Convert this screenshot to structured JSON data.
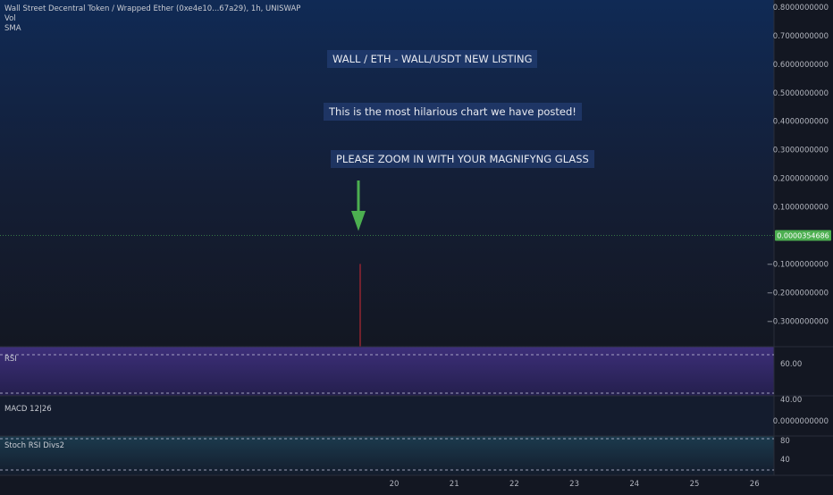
{
  "legend": {
    "symbol": "Wall Street Decentral Token / Wrapped Ether (0xe4e10...67a29), 1h, UNISWAP",
    "vol": "Vol",
    "sma": "SMA"
  },
  "annotations": {
    "headline": "WALL / ETH - WALL/USDT NEW LISTING",
    "comment": "This is the most hilarious chart we have posted!",
    "instruction": "PLEASE ZOOM IN WITH YOUR MAGNIFYNG GLASS"
  },
  "colors": {
    "background": "#131722",
    "price_line": "#4caf50",
    "candle": "#b22833",
    "arrow": "#4caf50",
    "rsi_band": "#5b3f9e"
  },
  "chart_data": [
    {
      "type": "line",
      "name": "price",
      "y_ticks": [
        "0.8000000000",
        "0.7000000000",
        "0.6000000000",
        "0.5000000000",
        "0.4000000000",
        "0.3000000000",
        "0.2000000000",
        "0.1000000000",
        "−0.1000000000",
        "−0.2000000000",
        "−0.3000000000"
      ],
      "ylim": [
        -0.39,
        0.8
      ],
      "last_price_label": "0.0000354686",
      "last_price": 3.54686e-05,
      "candle_low": -0.39,
      "candle_high": -0.1,
      "x_ticks": [
        "20",
        "21",
        "22",
        "23",
        "24",
        "25",
        "26"
      ]
    },
    {
      "type": "line",
      "name": "RSI",
      "label": "RSI",
      "y_ticks": [
        "60.00",
        "40.00"
      ]
    },
    {
      "type": "line",
      "name": "MACD",
      "label": "MACD 12|26",
      "y_ticks": [
        "0.0000000000"
      ]
    },
    {
      "type": "line",
      "name": "Stoch RSI",
      "label": "Stoch RSI Divs2",
      "y_ticks": [
        "80",
        "40"
      ]
    }
  ]
}
